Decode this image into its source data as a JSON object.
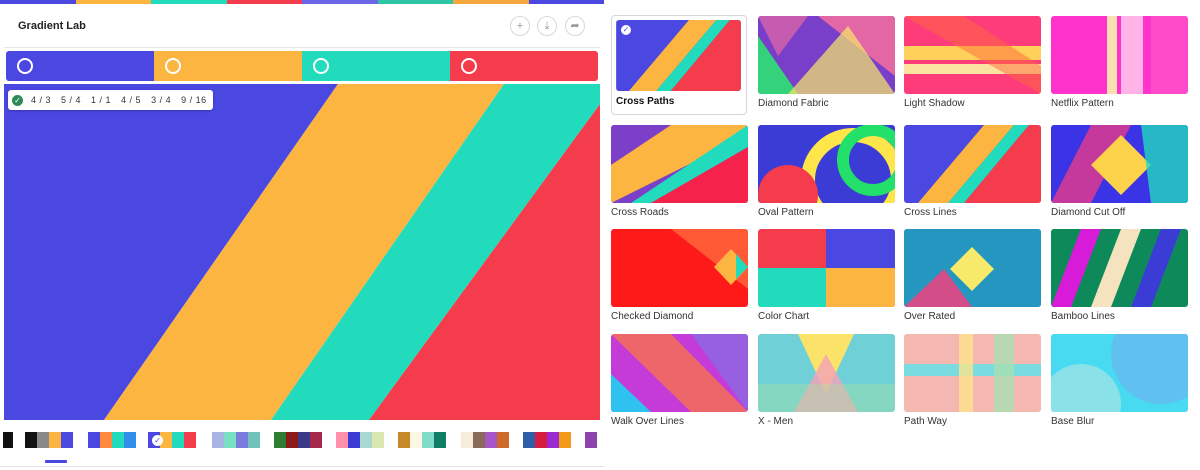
{
  "app": {
    "title": "Gradient Lab"
  },
  "header": {
    "add_icon": "plus-circle-icon",
    "download_icon": "download-icon",
    "share_icon": "share-arrow-icon"
  },
  "top_stripe_colors": [
    "#4b47e1",
    "#fbb540",
    "#22dbbd",
    "#f53c4c",
    "#6c67e6",
    "#2ec4a6",
    "#f6a840",
    "#4b47e1"
  ],
  "color_stops": [
    {
      "color": "#4b47e1"
    },
    {
      "color": "#fbb540"
    },
    {
      "color": "#22dbbd"
    },
    {
      "color": "#f53c4c"
    }
  ],
  "ratios": [
    "4 / 3",
    "5 / 4",
    "1 / 1",
    "4 / 5",
    "3 / 4",
    "9 / 16"
  ],
  "palettes": [
    [
      "#111111"
    ],
    [
      "#111111",
      "#888888",
      "#fbb540",
      "#4b47e1"
    ],
    [
      "#4b47e1",
      "#ff8a3d",
      "#22dbbd",
      "#2f8fea"
    ],
    [
      "#4b47e1",
      "#fbb540",
      "#22dbbd",
      "#f53c4c"
    ],
    [
      "#a9b4e6",
      "#7ae0c2",
      "#7d7adf",
      "#6fc2b8"
    ],
    [
      "#2e7d32",
      "#8b1a1a",
      "#3a3a8a",
      "#a3284a"
    ],
    [
      "#ff8fab",
      "#3b3bd6",
      "#a8d8d0",
      "#d8e8b0"
    ],
    [
      "#c7882a",
      "#fdf6e3",
      "#7fdcc8",
      "#0f7d63"
    ],
    [
      "#f5ecd9",
      "#8a6b5a",
      "#a855c8",
      "#d06a2a"
    ],
    [
      "#2f5fa8",
      "#d81b40",
      "#9b2bd1",
      "#f29a1b"
    ],
    [
      "#8e44ad"
    ]
  ],
  "gallery": [
    {
      "name": "Cross Paths",
      "selected": true,
      "colors": [
        "#4b47e1",
        "#fbb540",
        "#22dbbd",
        "#f53c4c"
      ]
    },
    {
      "name": "Diamond Fabric",
      "colors": [
        "#7a3fc9",
        "#34d27a",
        "#f76f9f",
        "#f7e96a"
      ]
    },
    {
      "name": "Light Shadow",
      "colors": [
        "#ff3c7a",
        "#ffd05a",
        "#fbe3a0",
        "#ff6a3c"
      ]
    },
    {
      "name": "Netflix Pattern",
      "colors": [
        "#ff33cc",
        "#ffb3e6",
        "#f8e0b0",
        "#ff5ac8"
      ]
    },
    {
      "name": "Cross Roads",
      "colors": [
        "#7c3fc7",
        "#fbb540",
        "#22dbbd",
        "#f5234c"
      ]
    },
    {
      "name": "Oval Pattern",
      "colors": [
        "#3b3bd6",
        "#f53c4c",
        "#fde54a",
        "#22e06a"
      ]
    },
    {
      "name": "Cross Lines",
      "colors": [
        "#4b47e1",
        "#fbb540",
        "#22dbbd",
        "#f53c4c"
      ]
    },
    {
      "name": "Diamond Cut Off",
      "colors": [
        "#3b33e6",
        "#ff3c7a",
        "#fbd24a",
        "#22dbbd"
      ]
    },
    {
      "name": "Checked Diamond",
      "colors": [
        "#ff1a1a",
        "#ff6a3c",
        "#fbb540",
        "#22dbbd"
      ]
    },
    {
      "name": "Color Chart",
      "colors": [
        "#f53c4c",
        "#4b47e1",
        "#22dbbd",
        "#fbb540"
      ]
    },
    {
      "name": "Over Rated",
      "colors": [
        "#2a2aa8",
        "#22e0d0",
        "#f7e96a",
        "#ff3c7a"
      ]
    },
    {
      "name": "Bamboo Lines",
      "colors": [
        "#0e8a5a",
        "#d81bd8",
        "#f5e3c0",
        "#3b3bd6"
      ]
    },
    {
      "name": "Walk Over Lines",
      "colors": [
        "#c43bd8",
        "#ff7a3c",
        "#7a7ae6",
        "#2fc2f0"
      ]
    },
    {
      "name": "X - Men",
      "colors": [
        "#6fd0d8",
        "#fbe36a",
        "#f5a0b8",
        "#a8e0a0"
      ]
    },
    {
      "name": "Path Way",
      "colors": [
        "#f5b8b0",
        "#7adce0",
        "#fbe38a",
        "#a8e0b0"
      ]
    },
    {
      "name": "Base Blur",
      "colors": [
        "#40e0f0",
        "#7aa8f0",
        "#c0f0e0",
        "#5ac8f5"
      ]
    }
  ]
}
